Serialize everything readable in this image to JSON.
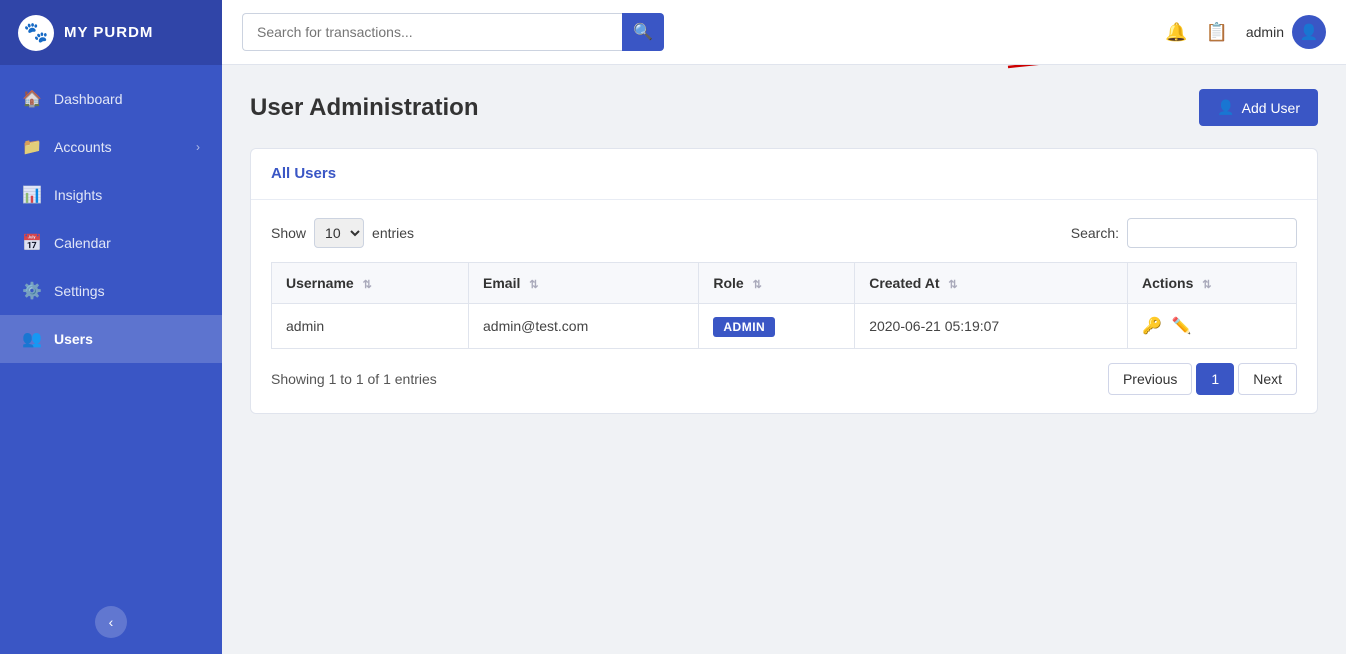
{
  "app": {
    "name": "MY PURDM"
  },
  "sidebar": {
    "items": [
      {
        "id": "dashboard",
        "label": "Dashboard",
        "icon": "🏠",
        "active": false
      },
      {
        "id": "accounts",
        "label": "Accounts",
        "icon": "📁",
        "active": false,
        "hasArrow": true
      },
      {
        "id": "insights",
        "label": "Insights",
        "icon": "📊",
        "active": false
      },
      {
        "id": "calendar",
        "label": "Calendar",
        "icon": "📅",
        "active": false
      },
      {
        "id": "settings",
        "label": "Settings",
        "icon": "⚙️",
        "active": false
      },
      {
        "id": "users",
        "label": "Users",
        "icon": "👥",
        "active": true
      }
    ],
    "collapse_icon": "‹"
  },
  "topbar": {
    "search_placeholder": "Search for transactions...",
    "search_icon": "🔍",
    "notification_icon": "🔔",
    "message_icon": "📋",
    "username": "admin"
  },
  "page": {
    "title": "User Administration",
    "add_user_label": "Add User",
    "card_title": "All Users",
    "show_label": "Show",
    "entries_label": "entries",
    "entries_value": "10",
    "search_label": "Search:",
    "search_placeholder": "",
    "showing_text": "Showing 1 to 1 of 1 entries",
    "table": {
      "columns": [
        {
          "key": "username",
          "label": "Username"
        },
        {
          "key": "email",
          "label": "Email"
        },
        {
          "key": "role",
          "label": "Role"
        },
        {
          "key": "created_at",
          "label": "Created At"
        },
        {
          "key": "actions",
          "label": "Actions"
        }
      ],
      "rows": [
        {
          "username": "admin",
          "email": "admin@test.com",
          "role": "ADMIN",
          "created_at": "2020-06-21 05:19:07"
        }
      ]
    },
    "pagination": {
      "previous_label": "Previous",
      "next_label": "Next",
      "current_page": "1"
    }
  }
}
